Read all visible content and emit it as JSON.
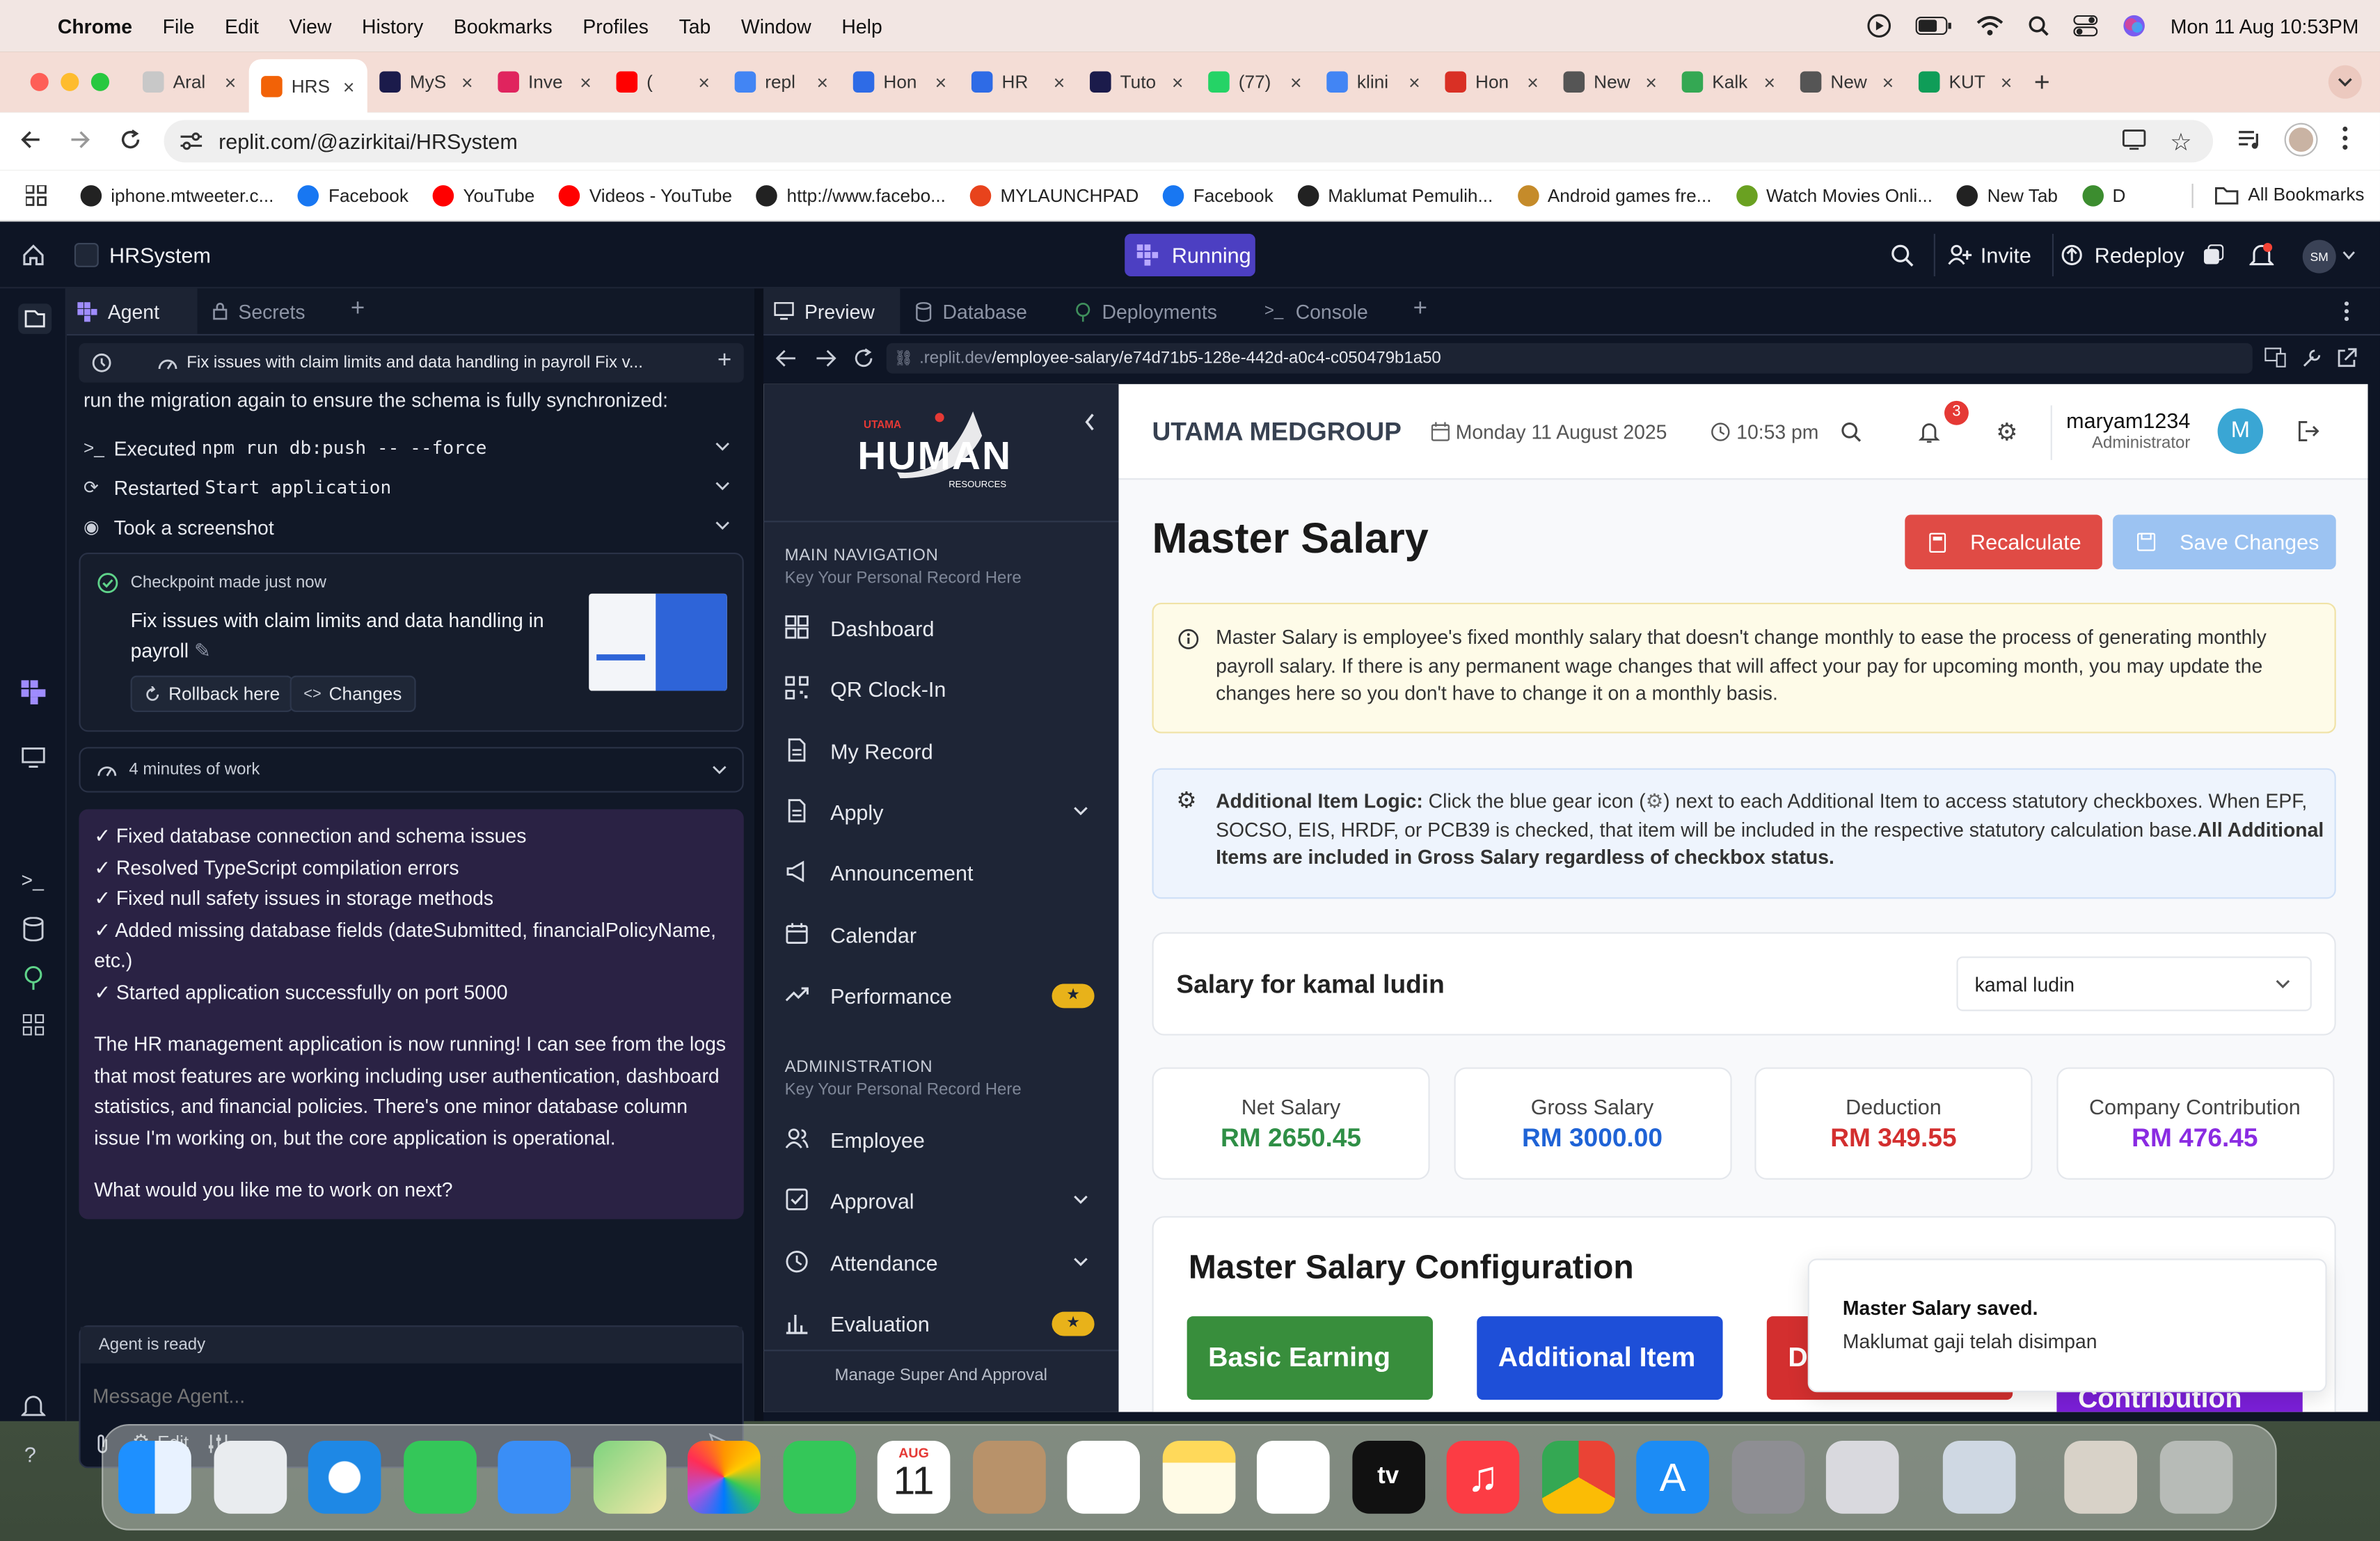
{
  "menubar": {
    "app": "Chrome",
    "items": [
      "File",
      "Edit",
      "View",
      "History",
      "Bookmarks",
      "Profiles",
      "Tab",
      "Window",
      "Help"
    ],
    "datetime": "Mon 11 Aug  10:53PM"
  },
  "tabs": [
    {
      "label": "Aral",
      "color": "#c8c8c8"
    },
    {
      "label": "HRS",
      "color": "#f26207",
      "active": true
    },
    {
      "label": "MyS",
      "color": "#1b1b4b"
    },
    {
      "label": "Inve",
      "color": "#e0245e"
    },
    {
      "label": "(",
      "color": "#ff0000"
    },
    {
      "label": "repl",
      "color": "#4285f4"
    },
    {
      "label": "Hon",
      "color": "#2e6be6"
    },
    {
      "label": "HR",
      "color": "#2e6be6"
    },
    {
      "label": "Tuto",
      "color": "#1b1b4b"
    },
    {
      "label": "(77)",
      "color": "#25d366"
    },
    {
      "label": "klini",
      "color": "#4285f4"
    },
    {
      "label": "Hon",
      "color": "#d93025"
    },
    {
      "label": "New",
      "color": "#555555"
    },
    {
      "label": "Kalk",
      "color": "#34a853"
    },
    {
      "label": "New",
      "color": "#555555"
    },
    {
      "label": "KUT",
      "color": "#0f9d58"
    }
  ],
  "address": {
    "url": "replit.com/@azirkitai/HRSystem"
  },
  "bookmarks": [
    {
      "label": "iphone.mtweeter.c...",
      "color": "#222222"
    },
    {
      "label": "Facebook",
      "color": "#1877f2"
    },
    {
      "label": "YouTube",
      "color": "#ff0000"
    },
    {
      "label": "Videos - YouTube",
      "color": "#ff0000"
    },
    {
      "label": "http://www.facebo...",
      "color": "#222222"
    },
    {
      "label": "MYLAUNCHPAD",
      "color": "#e8431c"
    },
    {
      "label": "Facebook",
      "color": "#1877f2"
    },
    {
      "label": "Maklumat Pemulih...",
      "color": "#222222"
    },
    {
      "label": "Android games fre...",
      "color": "#c58b2a"
    },
    {
      "label": "Watch Movies Onli...",
      "color": "#6aa121"
    },
    {
      "label": "New Tab",
      "color": "#222222"
    },
    {
      "label": "D",
      "color": "#3c8d2f"
    }
  ],
  "all_bookmarks": "All Bookmarks",
  "replit": {
    "project": "HRSystem",
    "running": "Running",
    "invite": "Invite",
    "redeploy": "Redeploy",
    "avatar": "SM",
    "left_tabs": [
      "Agent",
      "Secrets"
    ],
    "right_tabs": [
      "Preview",
      "Database",
      "Deployments",
      "Console"
    ],
    "preview_url_prefix": ".replit.dev",
    "preview_url_path": "/employee-salary/e74d71b5-128e-442d-a0c4-c050479b1a50"
  },
  "agent": {
    "thread_title": "Fix issues with claim limits and data handling in payroll Fix v...",
    "top_text": "run the migration again to ensure the schema is fully synchronized:",
    "steps": [
      {
        "prefix": "Executed ",
        "mono": "npm run db:push -- --force"
      },
      {
        "prefix": "Restarted ",
        "mono": "Start application"
      },
      {
        "prefix": "Took a screenshot",
        "mono": ""
      }
    ],
    "checkpoint_label": "Checkpoint made just now",
    "checkpoint_title": "Fix issues with claim limits and data handling in payroll",
    "rollback": "Rollback here",
    "changes": "Changes",
    "work_time": "4 minutes of work",
    "checks": [
      "✓ Fixed database connection and schema issues",
      "✓ Resolved TypeScript compilation errors",
      "✓ Fixed null safety issues in storage methods",
      "✓ Added missing database fields (dateSubmitted, financialPolicyName, etc.)",
      "✓ Started application successfully on port 5000"
    ],
    "paragraph": "The HR management application is now running! I can see from the logs that most features are working including user authentication, dashboard statistics, and financial policies. There's one minor database column issue I'm working on, but the core application is operational.",
    "question": "What would you like me to work on next?",
    "status": "Agent is ready",
    "input_placeholder": "Message Agent...",
    "edit": "Edit"
  },
  "hr": {
    "logo_top": "UTAMA",
    "logo_main": "HUMAN",
    "logo_sub": "RESOURCES",
    "main_nav_title": "MAIN NAVIGATION",
    "main_nav_sub": "Key Your Personal Record Here",
    "main_nav": [
      "Dashboard",
      "QR Clock-In",
      "My Record",
      "Apply",
      "Announcement",
      "Calendar",
      "Performance"
    ],
    "admin_title": "ADMINISTRATION",
    "admin_sub": "Key Your Personal Record Here",
    "admin_nav": [
      "Employee",
      "Approval",
      "Attendance",
      "Evaluation"
    ],
    "bottom": "Manage Super And Approval",
    "company": "UTAMA MEDGROUP",
    "date": "Monday 11 August 2025",
    "time": "10:53 pm",
    "notif_count": "3",
    "user_name": "maryam1234",
    "user_role": "Administrator",
    "user_initial": "M",
    "page_title": "Master Salary",
    "recalculate": "Recalculate",
    "save": "Save Changes",
    "info_text": "Master Salary is employee's fixed monthly salary that doesn't change monthly to ease the process of generating monthly payroll salary. If there is any permanent wage changes that will affect your pay for upcoming month, you may update the changes here so you don't have to change it on a monthly basis.",
    "logic_label": "Additional Item Logic:",
    "logic_text1": " Click the blue gear icon (",
    "logic_text2": ") next to each Additional Item to access statutory checkboxes. When EPF, SOCSO, EIS, HRDF, or PCB39 is checked, that item will be included in the respective statutory calculation base.",
    "logic_bold2": "All Additional Items are included in Gross Salary regardless of checkbox status.",
    "salary_for": "Salary for kamal ludin",
    "employee_select": "kamal ludin",
    "stats": [
      {
        "label": "Net Salary",
        "value": "RM 2650.45",
        "color": "#2f8f46"
      },
      {
        "label": "Gross Salary",
        "value": "RM 3000.00",
        "color": "#1f63d6"
      },
      {
        "label": "Deduction",
        "value": "RM 349.55",
        "color": "#d32f2f"
      },
      {
        "label": "Company Contribution",
        "value": "RM 476.45",
        "color": "#8a2be2"
      }
    ],
    "config_title": "Master Salary Configuration",
    "config_buttons": [
      {
        "label": "Basic Earning",
        "color": "#388e3c"
      },
      {
        "label": "Additional Item",
        "color": "#1e4fd8"
      },
      {
        "label": "D",
        "color": "#d32f2f"
      },
      {
        "label": "Contribution",
        "color": "#7b1fd8"
      }
    ],
    "toast_title": "Master Salary saved.",
    "toast_body": "Maklumat gaji telah disimpan"
  },
  "dock": {
    "calendar_month": "AUG",
    "calendar_day": "11"
  }
}
